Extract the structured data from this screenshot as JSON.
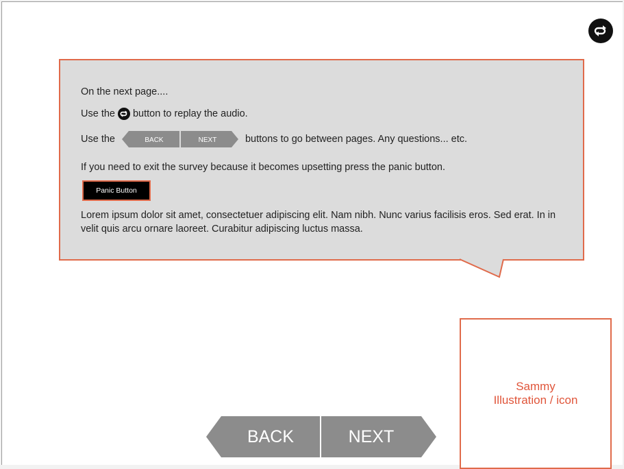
{
  "callout": {
    "line1": "On the next page....",
    "line2_before": "Use the",
    "line2_after": "button to replay the audio.",
    "line3_before": "Use the",
    "line3_after": "buttons to go between pages. Any questions... etc.",
    "line4": "If you need to exit the survey because it becomes upsetting press the panic button.",
    "panic_label": "Panic Button",
    "lorem": "Lorem ipsum dolor sit amet, consectetuer adipiscing elit. Nam nibh. Nunc varius facilisis eros. Sed erat. In in velit quis arcu ornare laoreet. Curabitur adipiscing luctus massa.",
    "mini_back_label": "BACK",
    "mini_next_label": "NEXT"
  },
  "illustration": {
    "line1": "Sammy",
    "line2": "Illustration / icon"
  },
  "nav": {
    "back_label": "BACK",
    "next_label": "NEXT"
  },
  "colors": {
    "accent": "#e06a4a",
    "callout_bg": "#dcdcdc",
    "nav_gray": "#8c8c8c",
    "dark": "#111111"
  },
  "icons": {
    "replay": "replay-icon"
  }
}
